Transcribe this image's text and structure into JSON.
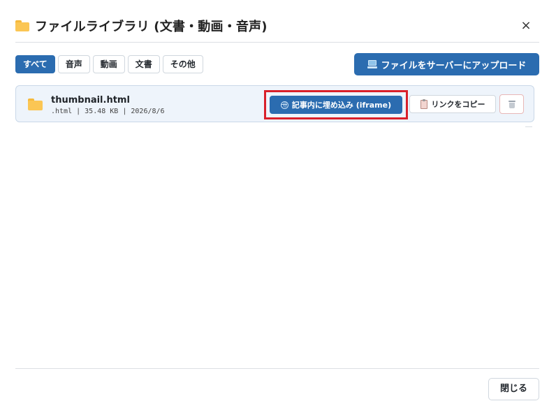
{
  "dialog": {
    "title": "ファイルライブラリ (文書・動画・音声)",
    "title_icon": "folder-icon",
    "close_glyph": "×"
  },
  "filters": [
    {
      "label": "すべて",
      "active": true
    },
    {
      "label": "音声",
      "active": false
    },
    {
      "label": "動画",
      "active": false
    },
    {
      "label": "文書",
      "active": false
    },
    {
      "label": "その他",
      "active": false
    }
  ],
  "upload_button": {
    "label": "ファイルをサーバーにアップロード",
    "icon": "laptop-icon"
  },
  "files": [
    {
      "name": "thumbnail.html",
      "meta": ".html | 35.48 KB | 2026/8/6",
      "icon": "folder-icon",
      "embed_label": "記事内に埋め込み (iframe)",
      "embed_icon": "globe-icon",
      "copy_label": "リンクをコピー",
      "copy_icon": "clipboard-icon",
      "delete_icon": "trash-icon"
    }
  ],
  "footer": {
    "close_label": "閉じる"
  },
  "colors": {
    "primary": "#2b6cb0",
    "highlight": "#d9202a",
    "row_bg": "#eef4fb"
  }
}
